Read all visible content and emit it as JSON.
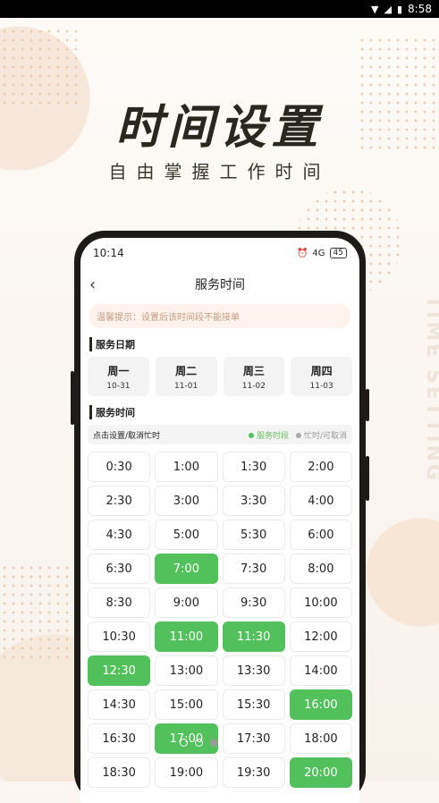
{
  "status_bar": {
    "time": "8:58"
  },
  "headline": "时间设置",
  "subline": "自由掌握工作时间",
  "vertical_text": "TIME SETTING",
  "phone": {
    "status_time": "10:14",
    "battery": "45",
    "signal": "4G",
    "nav_title": "服务时间",
    "tip": "温馨提示：设置后该时间段不能接单",
    "date_section": "服务日期",
    "days": [
      {
        "week": "周一",
        "date": "10-31"
      },
      {
        "week": "周二",
        "date": "11-01"
      },
      {
        "week": "周三",
        "date": "11-02"
      },
      {
        "week": "周四",
        "date": "11-03"
      }
    ],
    "time_section": "服务时间",
    "legend_hint": "点击设置/取消忙时",
    "legend_service": "服务时段",
    "legend_busy": "忙时/可取消",
    "slots": [
      {
        "t": "0:30",
        "on": false
      },
      {
        "t": "1:00",
        "on": false
      },
      {
        "t": "1:30",
        "on": false
      },
      {
        "t": "2:00",
        "on": false
      },
      {
        "t": "2:30",
        "on": false
      },
      {
        "t": "3:00",
        "on": false
      },
      {
        "t": "3:30",
        "on": false
      },
      {
        "t": "4:00",
        "on": false
      },
      {
        "t": "4:30",
        "on": false
      },
      {
        "t": "5:00",
        "on": false
      },
      {
        "t": "5:30",
        "on": false
      },
      {
        "t": "6:00",
        "on": false
      },
      {
        "t": "6:30",
        "on": false
      },
      {
        "t": "7:00",
        "on": true
      },
      {
        "t": "7:30",
        "on": false
      },
      {
        "t": "8:00",
        "on": false
      },
      {
        "t": "8:30",
        "on": false
      },
      {
        "t": "9:00",
        "on": false
      },
      {
        "t": "9:30",
        "on": false
      },
      {
        "t": "10:00",
        "on": false
      },
      {
        "t": "10:30",
        "on": false
      },
      {
        "t": "11:00",
        "on": true
      },
      {
        "t": "11:30",
        "on": true
      },
      {
        "t": "12:00",
        "on": false
      },
      {
        "t": "12:30",
        "on": true
      },
      {
        "t": "13:00",
        "on": false
      },
      {
        "t": "13:30",
        "on": false
      },
      {
        "t": "14:00",
        "on": false
      },
      {
        "t": "14:30",
        "on": false
      },
      {
        "t": "15:00",
        "on": false
      },
      {
        "t": "15:30",
        "on": false
      },
      {
        "t": "16:00",
        "on": true
      },
      {
        "t": "16:30",
        "on": false
      },
      {
        "t": "17:00",
        "on": true
      },
      {
        "t": "17:30",
        "on": false
      },
      {
        "t": "18:00",
        "on": false
      },
      {
        "t": "18:30",
        "on": false
      },
      {
        "t": "19:00",
        "on": false
      },
      {
        "t": "19:30",
        "on": false
      },
      {
        "t": "20:00",
        "on": true
      }
    ]
  },
  "colors": {
    "active": "#52c05b",
    "accent_dark": "#2a2620"
  },
  "pager": {
    "count": 3,
    "active": 2
  }
}
